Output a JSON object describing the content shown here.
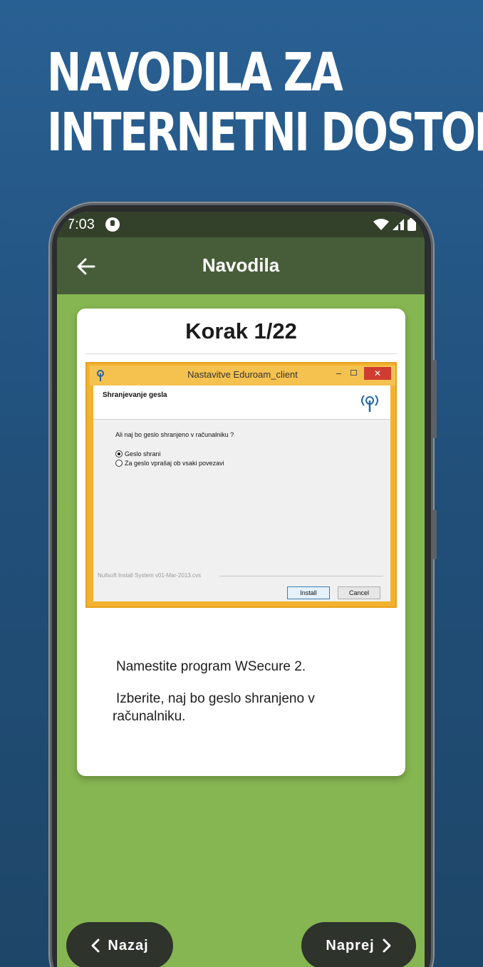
{
  "headline": {
    "line1": "NAVODILA ZA",
    "line2": "INTERNETNI DOSTOP"
  },
  "status_bar": {
    "time": "7:03",
    "icons": [
      "app-notification-icon",
      "wifi-icon",
      "signal-icon",
      "battery-icon"
    ]
  },
  "app_bar": {
    "title": "Navodila",
    "back_icon": "arrow-left-icon"
  },
  "card": {
    "title": "Korak 1/22",
    "screenshot": {
      "window_title": "Nastavitve Eduroam_client",
      "header_title": "Shranjevanje gesla",
      "question": "Ali naj bo geslo shranjeno v računalniku ?",
      "options": [
        "Geslo shrani",
        "Za geslo vprašaj ob vsaki povezavi"
      ],
      "selected_option": "Geslo shrani",
      "footer": "Nullsoft Install System v01-Mar-2013.cvs",
      "install_label": "Install",
      "cancel_label": "Cancel"
    },
    "paragraph1": "Namestite program WSecure 2.",
    "paragraph2_line1": "Izberite, naj bo geslo shranjeno v",
    "paragraph2_line2": "računalniku."
  },
  "navigation": {
    "back_label": "Nazaj",
    "next_label": "Naprej"
  },
  "colors": {
    "background": "#296093",
    "status_bar": "#33402a",
    "app_bar": "#475d39",
    "screen_background": "#86b651",
    "nav_button": "#2e332c"
  }
}
